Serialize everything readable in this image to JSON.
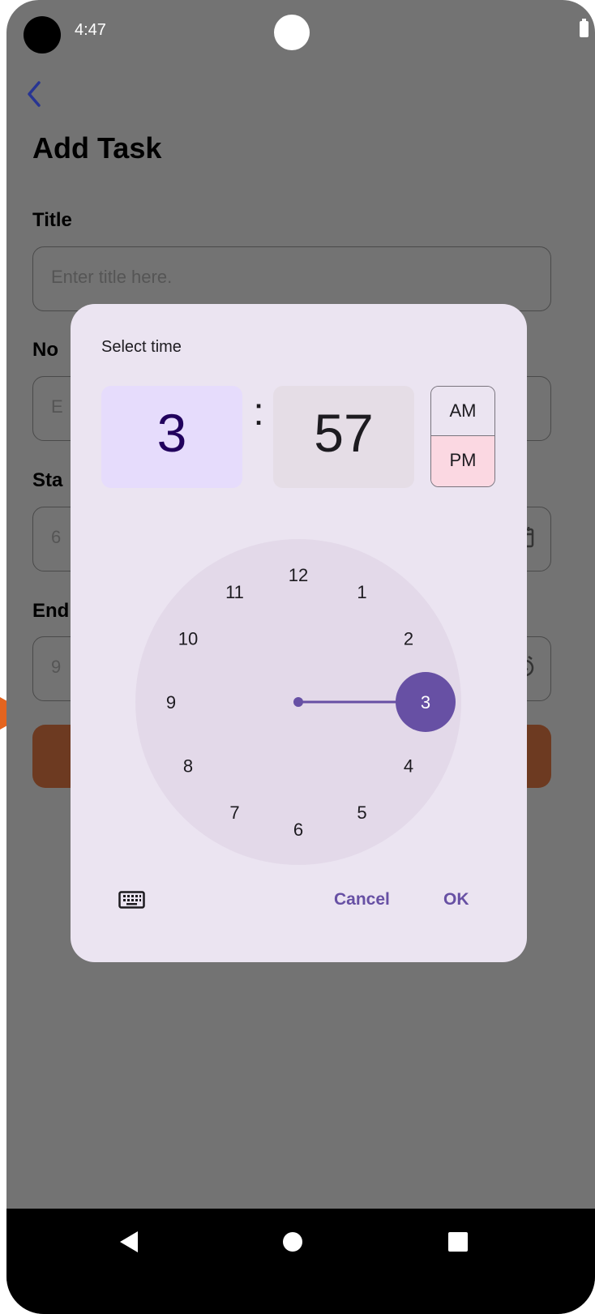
{
  "status_bar": {
    "time": "4:47"
  },
  "screen": {
    "title": "Add Task",
    "fields": [
      {
        "label": "Title",
        "placeholder": "Enter title here."
      },
      {
        "label": "No",
        "value": "E"
      },
      {
        "label": "Sta",
        "value": "6"
      },
      {
        "label": "End",
        "value": "9"
      }
    ]
  },
  "dialog": {
    "title": "Select time",
    "hour": "3",
    "separator": ":",
    "minute": "57",
    "am_label": "AM",
    "pm_label": "PM",
    "selected_period": "PM",
    "selected_hour": 3,
    "dial_numbers": [
      "12",
      "1",
      "2",
      "3",
      "4",
      "5",
      "6",
      "7",
      "8",
      "9",
      "10",
      "11"
    ],
    "cancel_label": "Cancel",
    "ok_label": "OK",
    "accent_color": "#6750a4"
  },
  "colors": {
    "scrim": "#737373",
    "dialog_bg": "#ebe4f1",
    "hour_selected_bg": "#e6dcfc",
    "pm_selected_bg": "#fbd8e2",
    "tooltip_arrow": "#e4641e",
    "create_button": "#6d3a21"
  }
}
